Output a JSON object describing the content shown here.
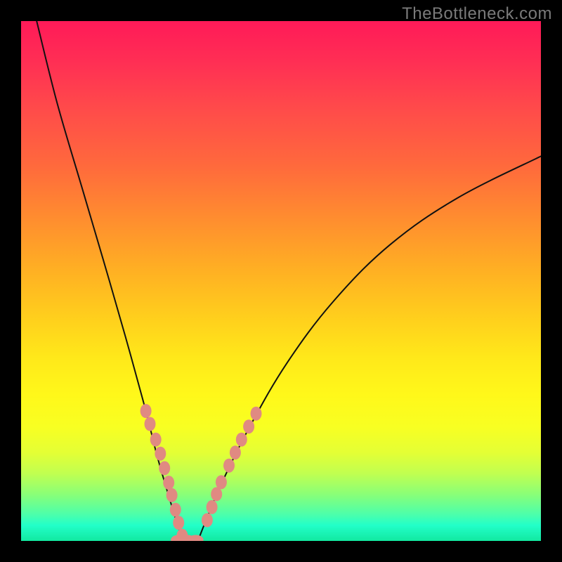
{
  "watermark": "TheBottleneck.com",
  "chart_data": {
    "type": "line",
    "title": "",
    "xlabel": "",
    "ylabel": "",
    "xlim": [
      0,
      100
    ],
    "ylim": [
      0,
      100
    ],
    "background_gradient": {
      "orientation": "vertical",
      "stops": [
        {
          "pos": 0,
          "color": "#ff1a58"
        },
        {
          "pos": 50,
          "color": "#ffb023"
        },
        {
          "pos": 70,
          "color": "#fff81a"
        },
        {
          "pos": 90,
          "color": "#8aff77"
        },
        {
          "pos": 100,
          "color": "#12e9a0"
        }
      ]
    },
    "series": [
      {
        "name": "left-curve",
        "x": [
          3,
          7,
          12,
          17,
          21,
          24,
          26,
          28,
          29.5,
          30.5,
          31
        ],
        "y": [
          100,
          84,
          67,
          50,
          36,
          25,
          17,
          10,
          5,
          2,
          0
        ]
      },
      {
        "name": "right-curve",
        "x": [
          34,
          36,
          39,
          44,
          51,
          60,
          71,
          84,
          100
        ],
        "y": [
          0,
          5,
          12,
          22,
          34,
          46,
          57,
          66,
          74
        ]
      }
    ],
    "annotations": {
      "left_markers_x": [
        24.0,
        24.8,
        25.9,
        26.8,
        27.6,
        28.4,
        29.0,
        29.7,
        30.3,
        31.0
      ],
      "left_markers_y": [
        25.0,
        22.5,
        19.5,
        16.8,
        14.0,
        11.2,
        8.8,
        6.0,
        3.5,
        1.0
      ],
      "right_markers_x": [
        35.8,
        36.7,
        37.6,
        38.5,
        40.0,
        41.2,
        42.4,
        43.8,
        45.2
      ],
      "right_markers_y": [
        4.0,
        6.5,
        9.0,
        11.3,
        14.5,
        17.0,
        19.5,
        22.0,
        24.5
      ],
      "valley_markers_x": [
        30.3,
        32.0,
        33.6
      ],
      "valley_markers_y": [
        0.2,
        0.2,
        0.2
      ]
    }
  }
}
